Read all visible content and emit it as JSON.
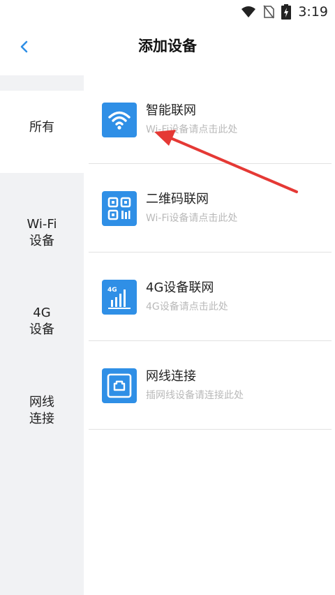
{
  "status_bar": {
    "time": "3:19"
  },
  "header": {
    "title": "添加设备"
  },
  "sidebar": {
    "items": [
      {
        "label": "所有"
      },
      {
        "label": "Wi-Fi\n设备"
      },
      {
        "label": "4G\n设备"
      },
      {
        "label": "网线\n连接"
      }
    ]
  },
  "options": [
    {
      "name": "智能联网",
      "desc": "Wi-Fi设备请点击此处",
      "icon": "wifi-icon"
    },
    {
      "name": "二维码联网",
      "desc": "Wi-Fi设备请点击此处",
      "icon": "qr-code-icon"
    },
    {
      "name": "4G设备联网",
      "desc": "4G设备请点击此处",
      "icon": "signal-4g-icon"
    },
    {
      "name": "网线连接",
      "desc": "插网线设备请连接此处",
      "icon": "ethernet-icon"
    }
  ],
  "colors": {
    "accent": "#2f8fe6",
    "sidebar_bg": "#f1f2f4",
    "annotation_arrow": "#e53935"
  }
}
